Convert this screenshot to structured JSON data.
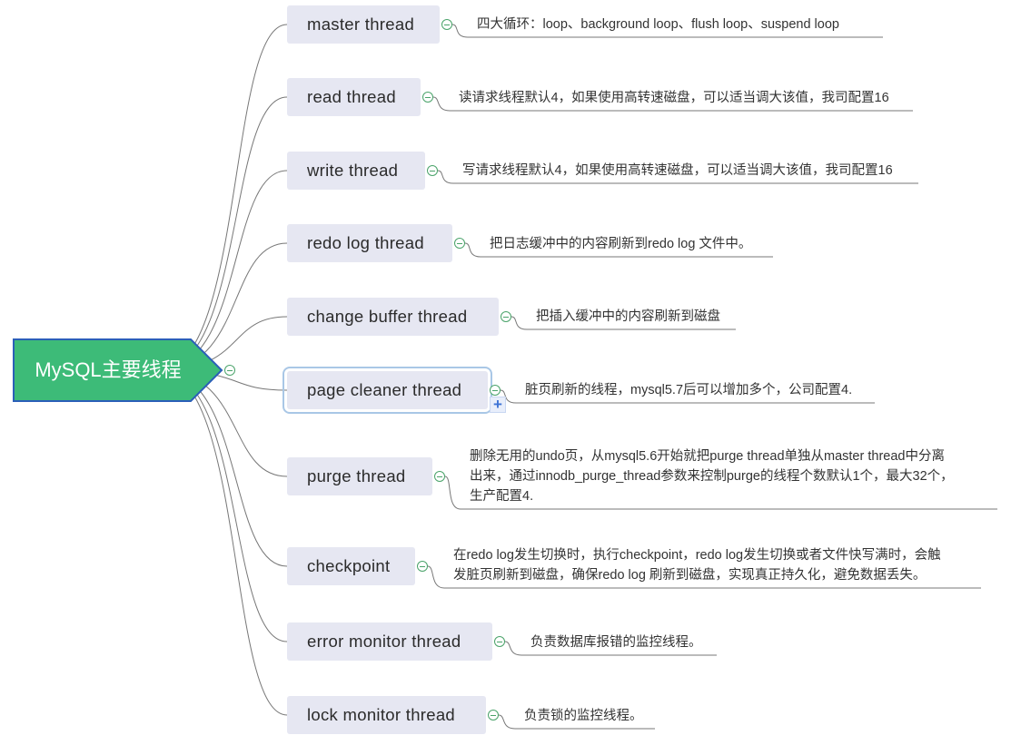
{
  "root": {
    "label": "MySQL主要线程",
    "fill": "#3dbb78",
    "stroke": "#2b5fb8"
  },
  "branches": [
    {
      "label": "master thread",
      "note": "四大循环：loop、background loop、flush loop、suspend loop"
    },
    {
      "label": "read thread",
      "note": "读请求线程默认4，如果使用高转速磁盘，可以适当调大该值，我司配置16"
    },
    {
      "label": "write thread",
      "note": "写请求线程默认4，如果使用高转速磁盘，可以适当调大该值，我司配置16"
    },
    {
      "label": "redo log thread",
      "note": "把日志缓冲中的内容刷新到redo log 文件中。"
    },
    {
      "label": "change buffer thread",
      "note": "把插入缓冲中的内容刷新到磁盘"
    },
    {
      "label": "page cleaner thread",
      "note": "脏页刷新的线程，mysql5.7后可以增加多个，公司配置4."
    },
    {
      "label": "purge thread",
      "note": "删除无用的undo页，从mysql5.6开始就把purge thread单独从master thread中分离\n出来，通过innodb_purge_thread参数来控制purge的线程个数默认1个，最大32个，\n生产配置4."
    },
    {
      "label": "checkpoint",
      "note": "在redo log发生切换时，执行checkpoint，redo log发生切换或者文件快写满时，会触\n发脏页刷新到磁盘，确保redo log 刷新到磁盘，实现真正持久化，避免数据丢失。"
    },
    {
      "label": "error monitor thread",
      "note": "负责数据库报错的监控线程。"
    },
    {
      "label": "lock monitor thread",
      "note": "负责锁的监控线程。"
    }
  ],
  "colors": {
    "topic_bg": "#e6e7f2",
    "line": "#777777",
    "toggle": "#4aa36a",
    "selection": "#a9c7e6",
    "plus": "#3d73d6"
  }
}
